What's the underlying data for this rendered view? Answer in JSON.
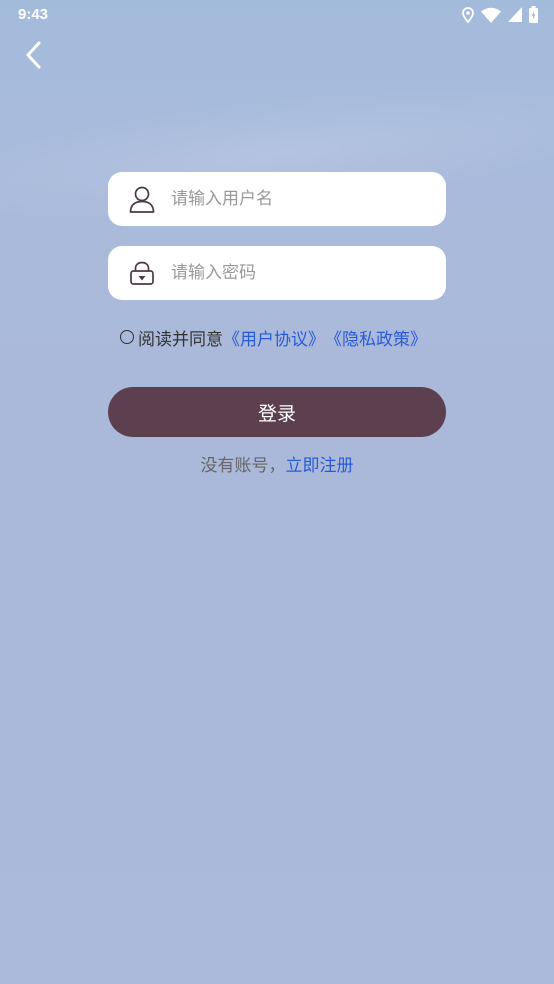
{
  "status_bar": {
    "time": "9:43",
    "icons": [
      "location-icon",
      "wifi-icon",
      "signal-icon",
      "battery-charging-icon"
    ]
  },
  "nav": {
    "back_icon": "chevron-left-icon"
  },
  "form": {
    "username": {
      "icon": "user-icon",
      "placeholder": "请输入用户名",
      "value": ""
    },
    "password": {
      "icon": "lock-icon",
      "placeholder": "请输入密码",
      "value": ""
    },
    "agreement": {
      "checked": false,
      "prefix": "阅读并同意",
      "user_agreement": "《用户协议》",
      "privacy_policy": "《隐私政策》"
    },
    "login_label": "登录",
    "register": {
      "prompt": "没有账号，",
      "link": "立即注册"
    }
  },
  "colors": {
    "background": "#aab9da",
    "button": "#5d404f",
    "link": "#2a5bd7",
    "icon_stroke": "#4a3a45"
  }
}
